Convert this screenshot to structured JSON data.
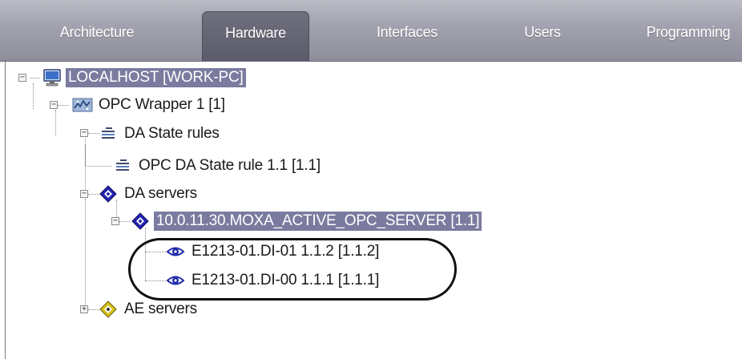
{
  "tabs": [
    {
      "label": "Architecture",
      "active": false
    },
    {
      "label": "Hardware",
      "active": true
    },
    {
      "label": "Interfaces",
      "active": false
    },
    {
      "label": "Users",
      "active": false
    },
    {
      "label": "Programming",
      "active": false
    }
  ],
  "tree": {
    "root": {
      "label": "LOCALHOST [WORK-PC]",
      "icon": "computer-icon",
      "selected": true,
      "expanded": true
    },
    "opc_wrapper": {
      "label": "OPC Wrapper 1 [1]",
      "icon": "opc-wrapper-icon",
      "expanded": true
    },
    "da_state_rules": {
      "label": "DA State rules",
      "icon": "state-rules-icon",
      "expanded": true
    },
    "opc_da_state_rule": {
      "label": "OPC DA State rule 1.1 [1.1]",
      "icon": "state-rule-icon"
    },
    "da_servers": {
      "label": "DA servers",
      "icon": "da-servers-icon",
      "expanded": true
    },
    "moxa_server": {
      "label": "10.0.11.30.MOXA_ACTIVE_OPC_SERVER [1.1]",
      "icon": "da-server-icon",
      "selected": true,
      "expanded": true
    },
    "di_01": {
      "label": "E1213-01.DI-01 1.1.2 [1.1.2]",
      "icon": "eye-icon"
    },
    "di_00": {
      "label": "E1213-01.DI-00 1.1.1 [1.1.1]",
      "icon": "eye-icon"
    },
    "ae_servers": {
      "label": "AE servers",
      "icon": "ae-servers-icon",
      "expanded": false
    }
  },
  "expander_symbols": {
    "expanded": "−",
    "collapsed": "+"
  },
  "colors": {
    "tabbar": "#a3a3b0",
    "active_tab": "#5b5b6a",
    "selection": "#7b7ba0",
    "da_icon": "#2323b0",
    "ae_icon": "#d4c21a"
  }
}
